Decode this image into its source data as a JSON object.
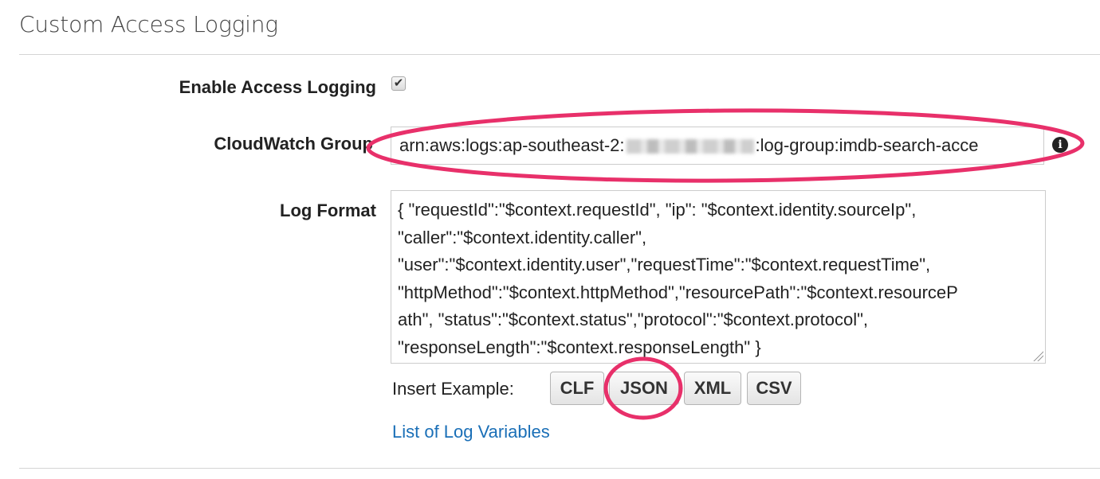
{
  "section": {
    "title": "Custom Access Logging"
  },
  "enable_logging": {
    "label": "Enable Access Logging",
    "checked": true,
    "check_glyph": "✔"
  },
  "cloudwatch_group": {
    "label": "CloudWatch Group",
    "value_prefix": "arn:aws:logs:ap-southeast-2:",
    "value_suffix": ":log-group:imdb-search-acce",
    "info_glyph": "i"
  },
  "log_format": {
    "label": "Log Format",
    "value": "{ \"requestId\":\"$context.requestId\", \"ip\": \"$context.identity.sourceIp\",\n\"caller\":\"$context.identity.caller\",\n\"user\":\"$context.identity.user\",\"requestTime\":\"$context.requestTime\",\n\"httpMethod\":\"$context.httpMethod\",\"resourcePath\":\"$context.resourceP\nath\", \"status\":\"$context.status\",\"protocol\":\"$context.protocol\",\n\"responseLength\":\"$context.responseLength\" }"
  },
  "insert_example": {
    "label": "Insert Example:",
    "buttons": [
      "CLF",
      "JSON",
      "XML",
      "CSV"
    ]
  },
  "links": {
    "log_variables": "List of Log Variables"
  },
  "colors": {
    "annotation": "#e8306a",
    "link": "#1a6fb7"
  }
}
